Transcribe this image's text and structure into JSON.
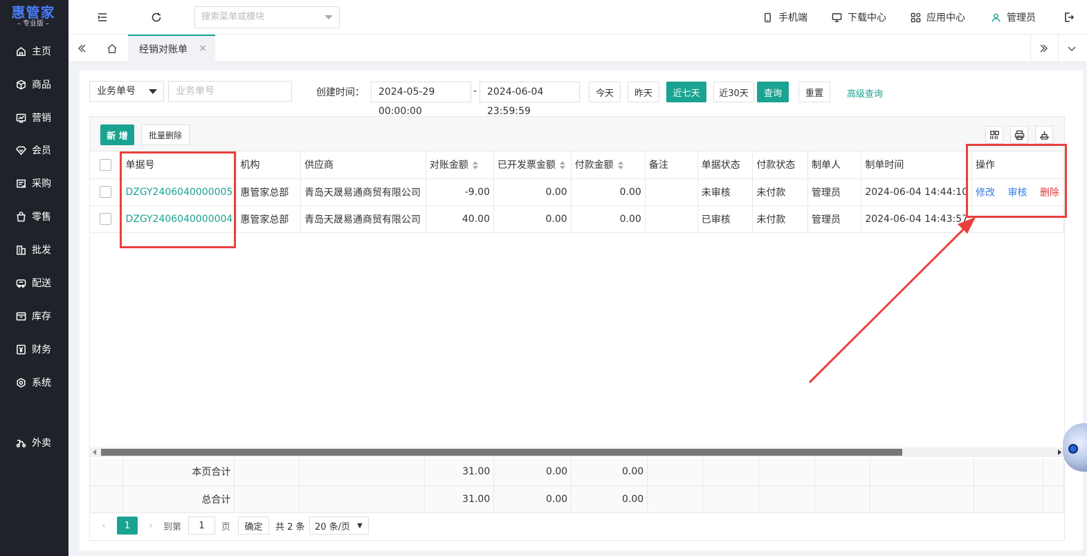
{
  "app": {
    "logo_title": "惠管家",
    "logo_sub": "– 专业版 –"
  },
  "sidebar": {
    "items": [
      {
        "label": "主页",
        "icon": "home-icon"
      },
      {
        "label": "商品",
        "icon": "box-icon"
      },
      {
        "label": "营销",
        "icon": "chart-icon"
      },
      {
        "label": "会员",
        "icon": "diamond-icon"
      },
      {
        "label": "采购",
        "icon": "purchase-icon"
      },
      {
        "label": "零售",
        "icon": "bag-icon"
      },
      {
        "label": "批发",
        "icon": "building-icon"
      },
      {
        "label": "配送",
        "icon": "truck-icon"
      },
      {
        "label": "库存",
        "icon": "inventory-icon"
      },
      {
        "label": "财务",
        "icon": "yen-icon"
      },
      {
        "label": "系统",
        "icon": "gear-icon"
      },
      {
        "label": "外卖",
        "icon": "scooter-icon"
      }
    ]
  },
  "topbar": {
    "search_placeholder": "搜索菜单或模块",
    "mobile": "手机端",
    "download": "下载中心",
    "apps": "应用中心",
    "user": "管理员"
  },
  "tabs": {
    "active": "经销对账单",
    "close": "×"
  },
  "filter": {
    "field_select": "业务单号",
    "field_input_placeholder": "业务单号",
    "create_time_label": "创建时间：",
    "date_start": "2024-05-29 00:00:00",
    "date_sep": "-",
    "date_end": "2024-06-04 23:59:59",
    "btn_today": "今天",
    "btn_yesterday": "昨天",
    "btn_7days": "近七天",
    "btn_30days": "近30天",
    "btn_query": "查询",
    "btn_reset": "重置",
    "advanced": "高级查询"
  },
  "toolbar": {
    "add": "新 增",
    "batch_delete": "批量删除"
  },
  "table": {
    "headers": [
      "单据号",
      "机构",
      "供应商",
      "对账金额",
      "已开发票金额",
      "付款金额",
      "备注",
      "单据状态",
      "付款状态",
      "制单人",
      "制单时间",
      "操作"
    ],
    "rows": [
      {
        "bill_no": "DZGY2406040000005",
        "org": "惠管家总部",
        "supplier": "青岛天晟易通商贸有限公司",
        "amount": "-9.00",
        "invoiced": "0.00",
        "paid": "0.00",
        "remark": "",
        "bill_status": "未审核",
        "pay_status": "未付款",
        "creator": "管理员",
        "created_at": "2024-06-04 14:44:10"
      },
      {
        "bill_no": "DZGY2406040000004",
        "org": "惠管家总部",
        "supplier": "青岛天晟易通商贸有限公司",
        "amount": "40.00",
        "invoiced": "0.00",
        "paid": "0.00",
        "remark": "",
        "bill_status": "已审核",
        "pay_status": "未付款",
        "creator": "管理员",
        "created_at": "2024-06-04 14:43:57"
      }
    ],
    "ops": {
      "edit": "修改",
      "audit": "审核",
      "delete": "删除"
    },
    "footer": [
      {
        "label": "本页合计",
        "amount": "31.00",
        "invoiced": "0.00",
        "paid": "0.00"
      },
      {
        "label": "总合计",
        "amount": "31.00",
        "invoiced": "0.00",
        "paid": "0.00"
      }
    ]
  },
  "pager": {
    "current": "1",
    "goto_label": "到第",
    "goto_value": "1",
    "page_unit": "页",
    "confirm": "确定",
    "total": "共 2 条",
    "page_size": "20 条/页"
  },
  "colors": {
    "primary": "#1aa391",
    "sidebar_bg": "#1f2229",
    "link_blue": "#2f7de1",
    "danger": "#e23b3b",
    "annotation": "#e8413b"
  }
}
